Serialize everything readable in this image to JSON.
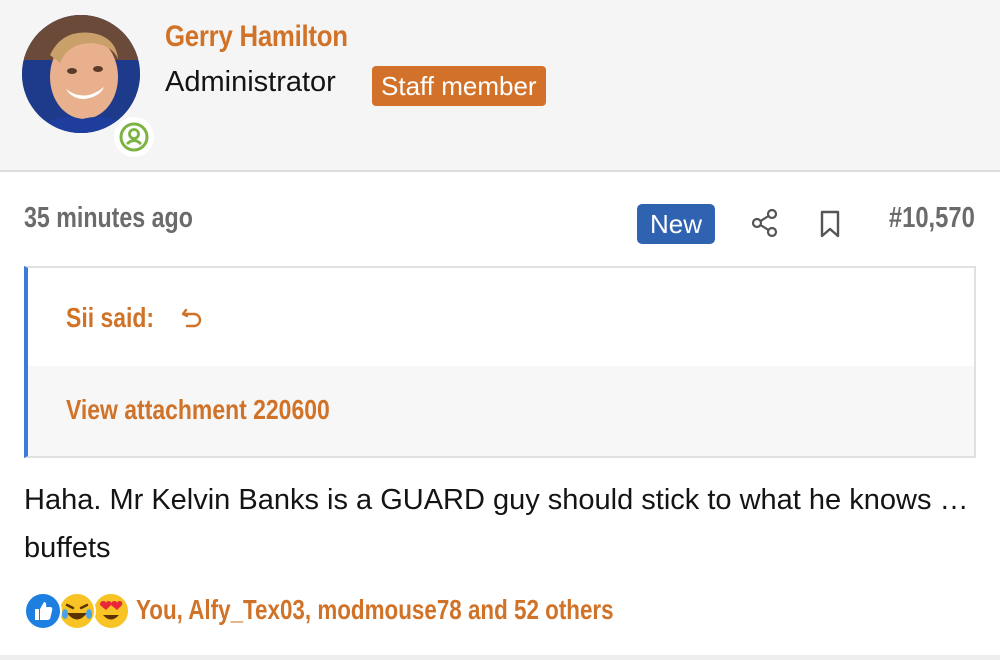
{
  "user": {
    "name": "Gerry Hamilton",
    "title": "Administrator",
    "badge": "Staff member",
    "avatar_icon": "user-avatar-photo",
    "online_icon": "online-user-icon"
  },
  "post": {
    "time": "35 minutes ago",
    "new_badge": "New",
    "share_icon": "share-icon",
    "bookmark_icon": "bookmark-icon",
    "number": "#10,570"
  },
  "quote": {
    "author": "Sii said:",
    "goto_icon": "goto-quote-icon",
    "attachment": "View attachment 220600"
  },
  "message": {
    "text": "Haha. Mr Kelvin Banks is a GUARD guy should stick to what he knows … buffets"
  },
  "reactions": {
    "icons": [
      "like-icon",
      "haha-icon",
      "love-icon"
    ],
    "summary": "You, Alfy_Tex03, modmouse78 and 52 others"
  },
  "colors": {
    "accent": "#d07328",
    "staff_badge": "#d2722a",
    "new_badge": "#2f62b0",
    "quote_border": "#3b7ad6",
    "online": "#7cb342"
  }
}
